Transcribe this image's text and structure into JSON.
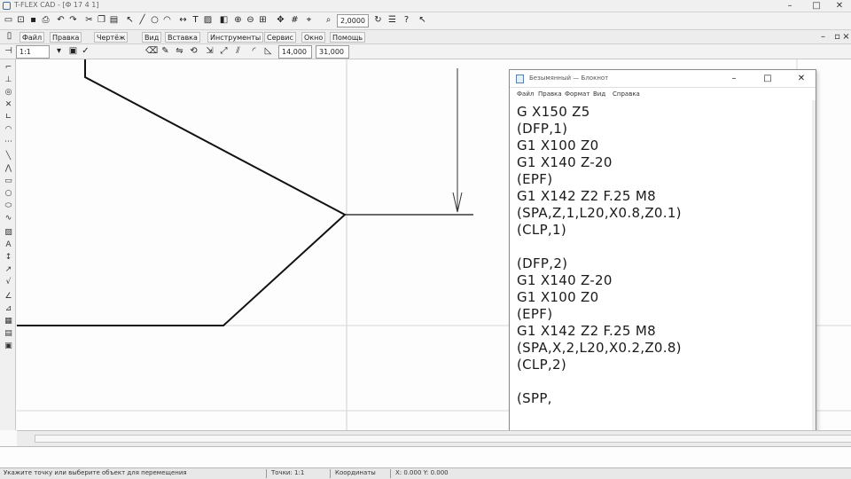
{
  "cad": {
    "title": "T-FLEX CAD - [Ф 17 4 1]",
    "menu": [
      "Файл",
      "Правка",
      "Чертёж",
      "Вид",
      "Вставка",
      "Инструменты",
      "Сервис",
      "Окно",
      "Помощь"
    ],
    "toolbar": {
      "scale_value": "1:1",
      "coord_x": "14,000",
      "coord_y": "31,000",
      "zoom_value": "2,0000"
    },
    "status": [
      "Укажите точку или выберите объект для перемещения",
      "Точки: 1:1",
      "Координаты",
      "X: 0.000 Y: 0.000"
    ]
  },
  "notepad": {
    "title": "Безымянный — Блокнот",
    "menu": [
      "Файл",
      "Правка",
      "Формат",
      "Вид",
      "Справка"
    ],
    "lines": [
      "G X150 Z5",
      "(DFP,1)",
      "G1 X100 Z0",
      "G1 X140 Z-20",
      "(EPF)",
      "G1 X142 Z2 F.25 M8",
      "(SPA,Z,1,L20,X0.8,Z0.1)",
      "(CLP,1)",
      "",
      "(DFP,2)",
      "G1 X140 Z-20",
      "G1 X100 Z0",
      "(EPF)",
      "G1 X142 Z2 F.25 M8",
      "(SPA,X,2,L20,X0.2,Z0.8)",
      "(CLP,2)",
      "",
      "(SPP,"
    ]
  }
}
